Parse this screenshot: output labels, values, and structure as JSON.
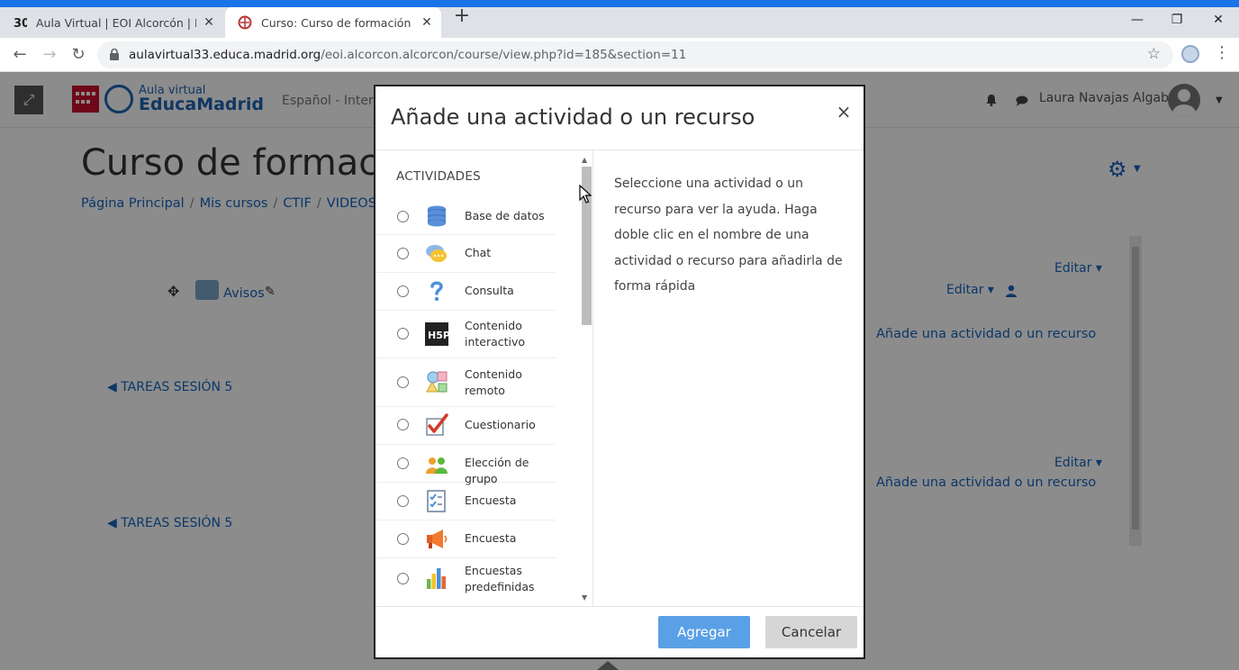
{
  "browser": {
    "tabs": [
      {
        "title": "Aula Virtual | EOI Alcorcón | Escu",
        "favicon": "eoi-favicon",
        "close": "✕"
      },
      {
        "title": "Curso: Curso de formación CTIF,",
        "favicon": "course-favicon",
        "close": "✕"
      }
    ],
    "new_tab": "+",
    "window": {
      "minimize": "—",
      "maximize": "❐",
      "close": "✕"
    },
    "back": "←",
    "forward": "→",
    "reload": "↻",
    "url_host": "aulavirtual33.educa.madrid.org",
    "url_path": "/eoi.alcorcon.alcorcon/course/view.php?id=185&section=11",
    "bookmark_star": "☆",
    "menu": "⋮"
  },
  "header": {
    "expand": "⤢",
    "logo_top": "Aula virtual",
    "logo_bottom": "EducaMadrid",
    "language": "Español - Intern",
    "user_name": "Laura Navajas Algaba",
    "user_caret": "▼"
  },
  "course": {
    "title": "Curso de formación",
    "breadcrumb": [
      "Página Principal",
      "Mis cursos",
      "CTIF",
      "VIDEOS"
    ],
    "gear": "⚙",
    "gear_caret": "▼",
    "move_icon": "✥",
    "forum_label": "Avisos",
    "pencil": "✎",
    "sections": [
      {
        "link": "◀ TAREAS SESIÓN 5",
        "editar": "Editar ▾",
        "add": "Añade una actividad o un recurso"
      },
      {
        "link": "◀ TAREAS SESIÓN 5",
        "editar": "Editar ▾",
        "add": "Añade una actividad o un recurso"
      }
    ],
    "top_editar": "Editar ▾"
  },
  "modal": {
    "title": "Añade una actividad o un recurso",
    "close": "×",
    "section_heading": "ACTIVIDADES",
    "items": [
      {
        "label": "Base de datos",
        "icon": "database-icon"
      },
      {
        "label": "Chat",
        "icon": "chat-icon"
      },
      {
        "label": "Consulta",
        "icon": "question-icon"
      },
      {
        "label": "Contenido interactivo",
        "icon": "h5p-icon"
      },
      {
        "label": "Contenido remoto",
        "icon": "shapes-icon"
      },
      {
        "label": "Cuestionario",
        "icon": "quiz-check-icon"
      },
      {
        "label": "Elección de grupo",
        "icon": "group-choice-icon"
      },
      {
        "label": "Encuesta",
        "icon": "survey-checklist-icon"
      },
      {
        "label": "Encuesta",
        "icon": "megaphone-icon"
      },
      {
        "label": "Encuestas predefinidas",
        "icon": "bar-chart-icon"
      }
    ],
    "help_text": "Seleccione una actividad o un recurso para ver la ayuda. Haga doble clic en el nombre de una actividad o recurso para añadirla de forma rápida",
    "add_button": "Agregar",
    "cancel_button": "Cancelar",
    "scroll_up": "▲",
    "scroll_down": "▼"
  },
  "colors": {
    "accent": "#1565c0",
    "primary_button": "#5aa0e6",
    "chrome_blue": "#1a73e8"
  }
}
